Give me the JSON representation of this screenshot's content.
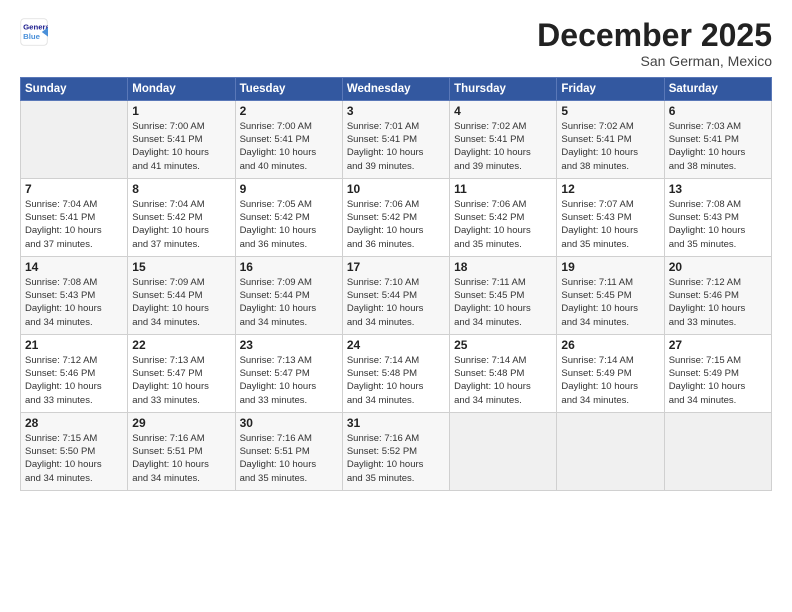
{
  "logo": {
    "line1": "General",
    "line2": "Blue",
    "icon": "▶"
  },
  "title": "December 2025",
  "subtitle": "San German, Mexico",
  "header_days": [
    "Sunday",
    "Monday",
    "Tuesday",
    "Wednesday",
    "Thursday",
    "Friday",
    "Saturday"
  ],
  "weeks": [
    [
      {
        "day": "",
        "info": ""
      },
      {
        "day": "1",
        "info": "Sunrise: 7:00 AM\nSunset: 5:41 PM\nDaylight: 10 hours\nand 41 minutes."
      },
      {
        "day": "2",
        "info": "Sunrise: 7:00 AM\nSunset: 5:41 PM\nDaylight: 10 hours\nand 40 minutes."
      },
      {
        "day": "3",
        "info": "Sunrise: 7:01 AM\nSunset: 5:41 PM\nDaylight: 10 hours\nand 39 minutes."
      },
      {
        "day": "4",
        "info": "Sunrise: 7:02 AM\nSunset: 5:41 PM\nDaylight: 10 hours\nand 39 minutes."
      },
      {
        "day": "5",
        "info": "Sunrise: 7:02 AM\nSunset: 5:41 PM\nDaylight: 10 hours\nand 38 minutes."
      },
      {
        "day": "6",
        "info": "Sunrise: 7:03 AM\nSunset: 5:41 PM\nDaylight: 10 hours\nand 38 minutes."
      }
    ],
    [
      {
        "day": "7",
        "info": "Sunrise: 7:04 AM\nSunset: 5:41 PM\nDaylight: 10 hours\nand 37 minutes."
      },
      {
        "day": "8",
        "info": "Sunrise: 7:04 AM\nSunset: 5:42 PM\nDaylight: 10 hours\nand 37 minutes."
      },
      {
        "day": "9",
        "info": "Sunrise: 7:05 AM\nSunset: 5:42 PM\nDaylight: 10 hours\nand 36 minutes."
      },
      {
        "day": "10",
        "info": "Sunrise: 7:06 AM\nSunset: 5:42 PM\nDaylight: 10 hours\nand 36 minutes."
      },
      {
        "day": "11",
        "info": "Sunrise: 7:06 AM\nSunset: 5:42 PM\nDaylight: 10 hours\nand 35 minutes."
      },
      {
        "day": "12",
        "info": "Sunrise: 7:07 AM\nSunset: 5:43 PM\nDaylight: 10 hours\nand 35 minutes."
      },
      {
        "day": "13",
        "info": "Sunrise: 7:08 AM\nSunset: 5:43 PM\nDaylight: 10 hours\nand 35 minutes."
      }
    ],
    [
      {
        "day": "14",
        "info": "Sunrise: 7:08 AM\nSunset: 5:43 PM\nDaylight: 10 hours\nand 34 minutes."
      },
      {
        "day": "15",
        "info": "Sunrise: 7:09 AM\nSunset: 5:44 PM\nDaylight: 10 hours\nand 34 minutes."
      },
      {
        "day": "16",
        "info": "Sunrise: 7:09 AM\nSunset: 5:44 PM\nDaylight: 10 hours\nand 34 minutes."
      },
      {
        "day": "17",
        "info": "Sunrise: 7:10 AM\nSunset: 5:44 PM\nDaylight: 10 hours\nand 34 minutes."
      },
      {
        "day": "18",
        "info": "Sunrise: 7:11 AM\nSunset: 5:45 PM\nDaylight: 10 hours\nand 34 minutes."
      },
      {
        "day": "19",
        "info": "Sunrise: 7:11 AM\nSunset: 5:45 PM\nDaylight: 10 hours\nand 34 minutes."
      },
      {
        "day": "20",
        "info": "Sunrise: 7:12 AM\nSunset: 5:46 PM\nDaylight: 10 hours\nand 33 minutes."
      }
    ],
    [
      {
        "day": "21",
        "info": "Sunrise: 7:12 AM\nSunset: 5:46 PM\nDaylight: 10 hours\nand 33 minutes."
      },
      {
        "day": "22",
        "info": "Sunrise: 7:13 AM\nSunset: 5:47 PM\nDaylight: 10 hours\nand 33 minutes."
      },
      {
        "day": "23",
        "info": "Sunrise: 7:13 AM\nSunset: 5:47 PM\nDaylight: 10 hours\nand 33 minutes."
      },
      {
        "day": "24",
        "info": "Sunrise: 7:14 AM\nSunset: 5:48 PM\nDaylight: 10 hours\nand 34 minutes."
      },
      {
        "day": "25",
        "info": "Sunrise: 7:14 AM\nSunset: 5:48 PM\nDaylight: 10 hours\nand 34 minutes."
      },
      {
        "day": "26",
        "info": "Sunrise: 7:14 AM\nSunset: 5:49 PM\nDaylight: 10 hours\nand 34 minutes."
      },
      {
        "day": "27",
        "info": "Sunrise: 7:15 AM\nSunset: 5:49 PM\nDaylight: 10 hours\nand 34 minutes."
      }
    ],
    [
      {
        "day": "28",
        "info": "Sunrise: 7:15 AM\nSunset: 5:50 PM\nDaylight: 10 hours\nand 34 minutes."
      },
      {
        "day": "29",
        "info": "Sunrise: 7:16 AM\nSunset: 5:51 PM\nDaylight: 10 hours\nand 34 minutes."
      },
      {
        "day": "30",
        "info": "Sunrise: 7:16 AM\nSunset: 5:51 PM\nDaylight: 10 hours\nand 35 minutes."
      },
      {
        "day": "31",
        "info": "Sunrise: 7:16 AM\nSunset: 5:52 PM\nDaylight: 10 hours\nand 35 minutes."
      },
      {
        "day": "",
        "info": ""
      },
      {
        "day": "",
        "info": ""
      },
      {
        "day": "",
        "info": ""
      }
    ]
  ]
}
